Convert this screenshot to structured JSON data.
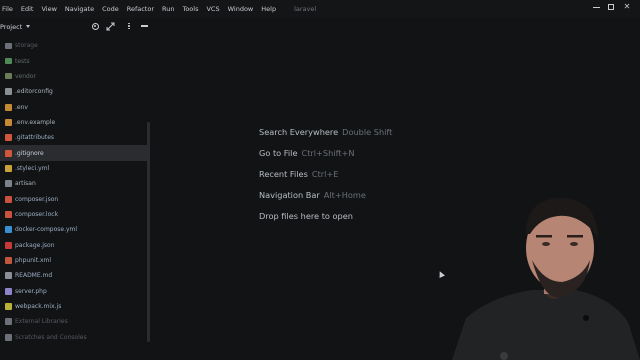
{
  "menu": {
    "items": [
      "File",
      "Edit",
      "View",
      "Navigate",
      "Code",
      "Refactor",
      "Run",
      "Tools",
      "VCS",
      "Window",
      "Help"
    ],
    "project_name": "laravel"
  },
  "panel": {
    "title": "Project"
  },
  "tree": [
    {
      "label": "storage",
      "icon": "folder-icon",
      "color": "#6b7079",
      "style": "muted"
    },
    {
      "label": "tests",
      "icon": "folder-icon",
      "color": "#4f8a57",
      "style": "dim"
    },
    {
      "label": "vendor",
      "icon": "folder-icon",
      "color": "#6b7d58",
      "style": "dim"
    },
    {
      "label": ".editorconfig",
      "icon": "config-icon",
      "color": "#8a8f96",
      "style": "plain"
    },
    {
      "label": ".env",
      "icon": "env-icon",
      "color": "#c58a33",
      "style": "plain"
    },
    {
      "label": ".env.example",
      "icon": "env-icon",
      "color": "#c58a33",
      "style": "plain"
    },
    {
      "label": ".gitattributes",
      "icon": "git-icon",
      "color": "#d0563c",
      "style": "blue"
    },
    {
      "label": ".gitignore",
      "icon": "git-icon",
      "color": "#d0563c",
      "style": "selected"
    },
    {
      "label": ".styleci.yml",
      "icon": "yaml-icon",
      "color": "#c9a23a",
      "style": "blue"
    },
    {
      "label": "artisan",
      "icon": "file-icon",
      "color": "#7d838b",
      "style": "plain"
    },
    {
      "label": "composer.json",
      "icon": "composer-icon",
      "color": "#c9513e",
      "style": "blue"
    },
    {
      "label": "composer.lock",
      "icon": "lock-icon",
      "color": "#c9513e",
      "style": "blue"
    },
    {
      "label": "docker-compose.yml",
      "icon": "docker-icon",
      "color": "#3a8fd1",
      "style": "blue"
    },
    {
      "label": "package.json",
      "icon": "npm-icon",
      "color": "#c43a3a",
      "style": "blue"
    },
    {
      "label": "phpunit.xml",
      "icon": "xml-icon",
      "color": "#c0563c",
      "style": "blue"
    },
    {
      "label": "README.md",
      "icon": "markdown-icon",
      "color": "#8a8f96",
      "style": "blue"
    },
    {
      "label": "server.php",
      "icon": "php-icon",
      "color": "#8d84c9",
      "style": "blue"
    },
    {
      "label": "webpack.mix.js",
      "icon": "js-icon",
      "color": "#b9b33a",
      "style": "blue"
    },
    {
      "label": "External Libraries",
      "icon": "library-icon",
      "color": "#6b7079",
      "style": "muted"
    },
    {
      "label": "Scratches and Consoles",
      "icon": "scratch-icon",
      "color": "#6b7079",
      "style": "muted"
    }
  ],
  "hints": [
    {
      "action": "Search Everywhere",
      "key": "Double Shift"
    },
    {
      "action": "Go to File",
      "key": "Ctrl+Shift+N"
    },
    {
      "action": "Recent Files",
      "key": "Ctrl+E"
    },
    {
      "action": "Navigation Bar",
      "key": "Alt+Home"
    },
    {
      "action": "Drop files here to open",
      "key": ""
    }
  ]
}
